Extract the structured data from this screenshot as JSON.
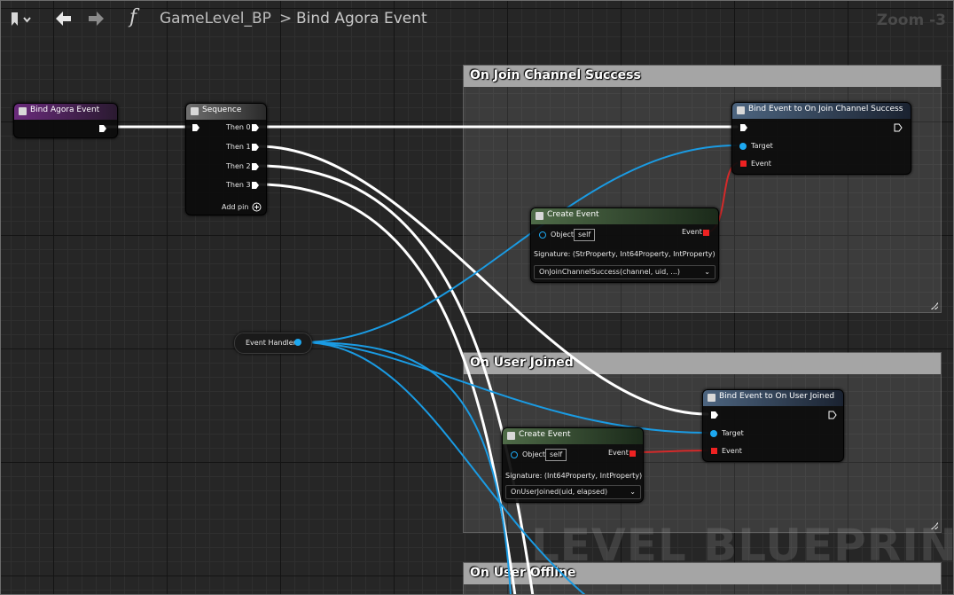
{
  "toolbar": {
    "breadcrumb_blueprint": "GameLevel_BP",
    "breadcrumb_separator": ">",
    "breadcrumb_function": "Bind Agora Event",
    "function_symbol": "f",
    "zoom": "Zoom -3"
  },
  "watermark": "LEVEL BLUEPRINT",
  "comments": {
    "join": "On Join Channel Success",
    "user_joined": "On User Joined",
    "user_offline": "On User Offline"
  },
  "nodes": {
    "bind_agora_event": {
      "title": "Bind Agora Event"
    },
    "sequence": {
      "title": "Sequence",
      "then0": "Then 0",
      "then1": "Then 1",
      "then2": "Then 2",
      "then3": "Then 3",
      "add_pin": "Add pin"
    },
    "event_handler": {
      "title": "Event Handler"
    },
    "bind_join": {
      "title": "Bind Event to On Join Channel Success",
      "target": "Target",
      "event": "Event"
    },
    "create_join": {
      "title": "Create Event",
      "object": "Object",
      "self": "self",
      "event": "Event",
      "signature": "Signature: (StrProperty, Int64Property, IntProperty)",
      "function": "OnJoinChannelSuccess(channel, uid, ...)"
    },
    "bind_user_joined": {
      "title": "Bind Event to On User Joined",
      "target": "Target",
      "event": "Event"
    },
    "create_user_joined": {
      "title": "Create Event",
      "object": "Object",
      "self": "self",
      "event": "Event",
      "signature": "Signature: (Int64Property, IntProperty)",
      "function": "OnUserJoined(uid, elapsed)"
    }
  },
  "colors": {
    "exec_wire": "#ffffff",
    "object_wire": "#1a9be3",
    "delegate_wire": "#d42a2a",
    "event_header": "#6a2b7c",
    "function_header": "#4d6580",
    "create_event_header": "#4f6b48",
    "sequence_header": "#6f6f6f",
    "comment_header": "#a5a5a5"
  },
  "icons": {
    "bookmark": "bookmark-icon",
    "back": "arrow-left-icon",
    "forward": "arrow-right-icon",
    "node": "node-icon",
    "add": "add-pin-icon",
    "dropdown": "chevron-down-icon"
  }
}
